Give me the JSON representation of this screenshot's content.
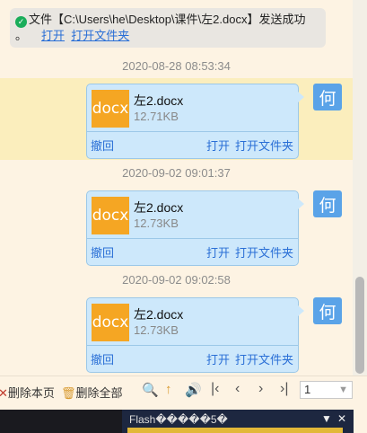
{
  "notice": {
    "text_prefix": "文件【C:\\Users\\he\\Desktop\\课件\\左2.docx】发送成功",
    "dot": "。",
    "open_link": "打开",
    "open_folder_link": "打开文件夹"
  },
  "messages": [
    {
      "timestamp": "2020-08-28 08:53:34",
      "file_type": "docx",
      "file_name": "左2.docx",
      "file_size": "12.71KB",
      "withdraw": "撤回",
      "open": "打开",
      "open_folder": "打开文件夹",
      "avatar": "何"
    },
    {
      "timestamp": "2020-09-02 09:01:37",
      "file_type": "docx",
      "file_name": "左2.docx",
      "file_size": "12.73KB",
      "withdraw": "撤回",
      "open": "打开",
      "open_folder": "打开文件夹",
      "avatar": "何"
    },
    {
      "timestamp": "2020-09-02 09:02:58",
      "file_type": "docx",
      "file_name": "左2.docx",
      "file_size": "12.73KB",
      "withdraw": "撤回",
      "open": "打开",
      "open_folder": "打开文件夹",
      "avatar": "何"
    }
  ],
  "toolbar": {
    "delete_page": "删除本页",
    "delete_all": "删除全部",
    "page_value": "1",
    "icons": [
      "close-icon",
      "trash-icon",
      "search-icon",
      "up-arrow-icon",
      "speaker-icon",
      "first-page-icon",
      "prev-page-icon",
      "next-page-icon",
      "last-page-icon"
    ]
  },
  "flash": {
    "title": "Flash�����5�",
    "minimize": "▼",
    "close": "✕"
  },
  "colors": {
    "background": "#fdf3e3",
    "card": "#cde8fb",
    "link": "#2a6fd6",
    "docx_icon": "#f5a623",
    "avatar": "#5aa3e8"
  }
}
